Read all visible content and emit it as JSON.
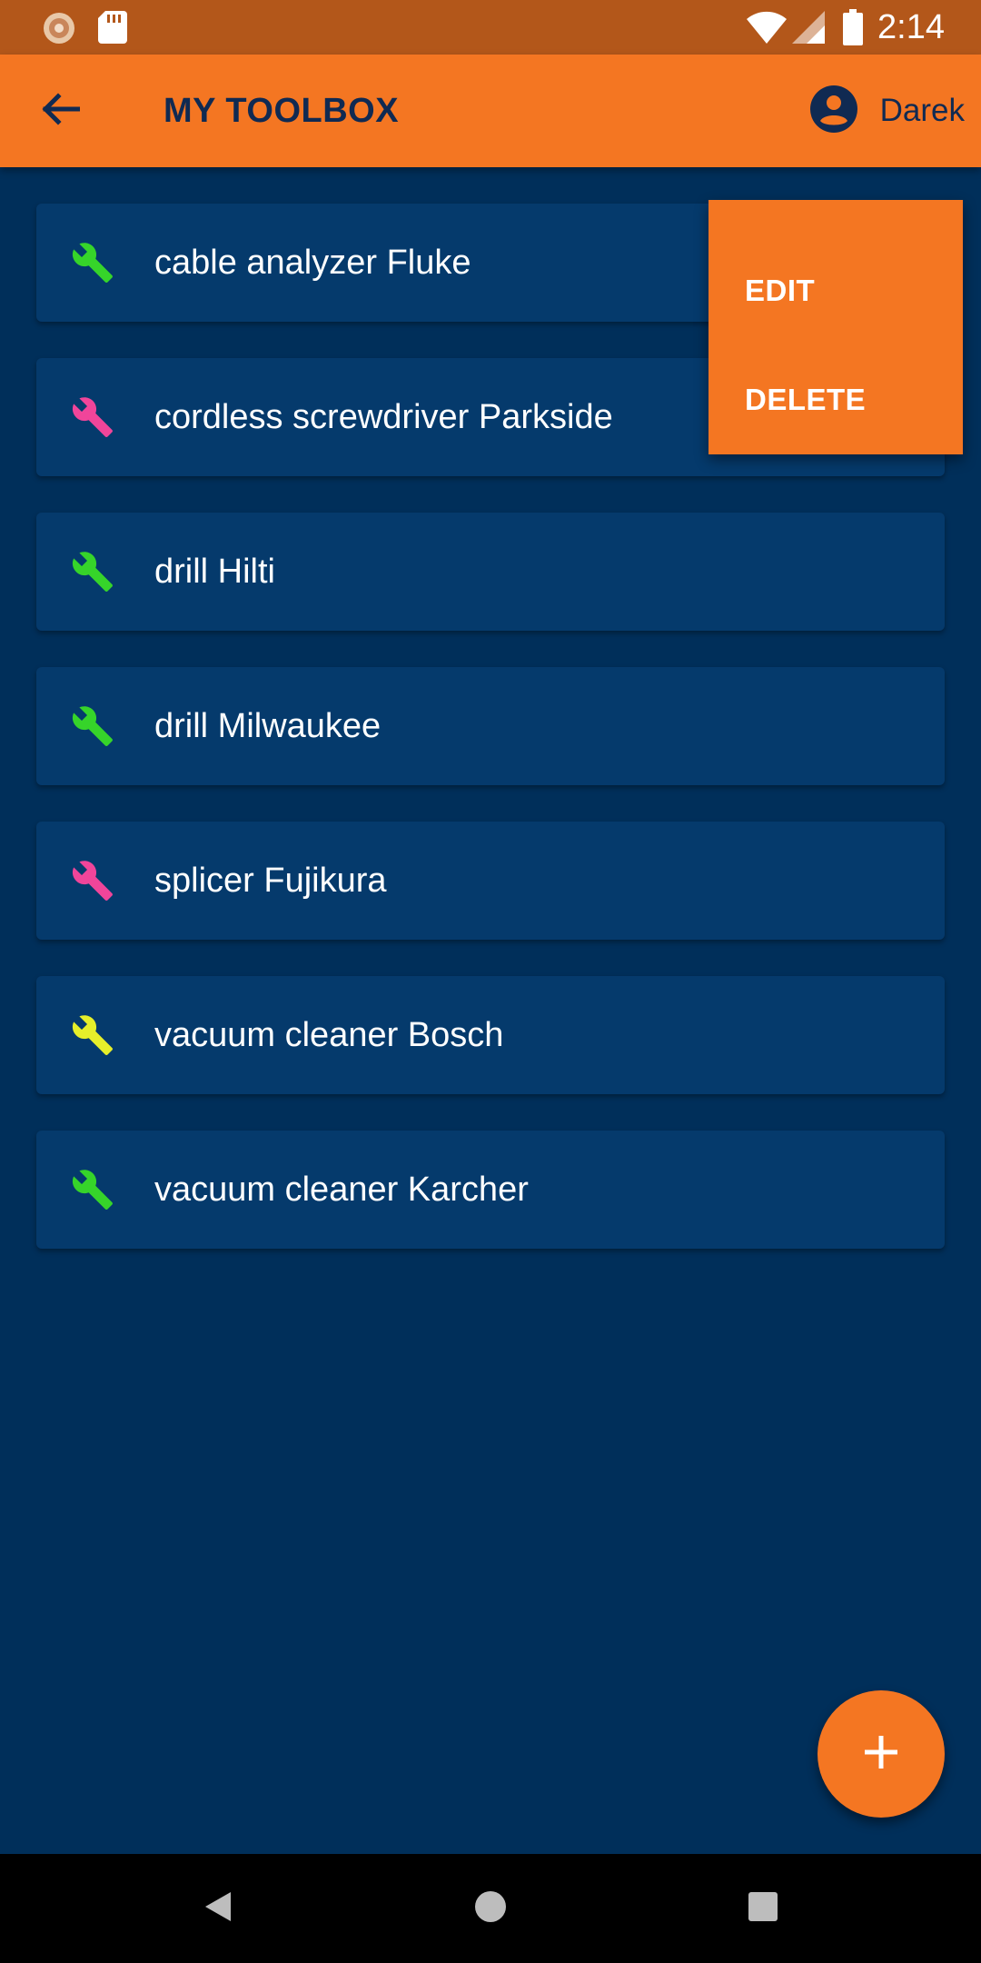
{
  "status_bar": {
    "time": "2:14",
    "icons": [
      "app-notification-icon",
      "sd-card-icon",
      "wifi-icon",
      "signal-icon",
      "battery-icon"
    ]
  },
  "app_bar": {
    "title": "MY TOOLBOX",
    "back_icon": "arrow-back-icon",
    "user_icon": "account-circle-icon",
    "user_name": "Darek"
  },
  "tools": [
    {
      "name": "cable analyzer Fluke",
      "icon": "wrench-icon",
      "color": "#36d42a"
    },
    {
      "name": "cordless screwdriver Parkside",
      "icon": "wrench-icon",
      "color": "#f0459a"
    },
    {
      "name": "drill Hilti",
      "icon": "wrench-icon",
      "color": "#36d42a"
    },
    {
      "name": "drill Milwaukee",
      "icon": "wrench-icon",
      "color": "#36d42a"
    },
    {
      "name": "splicer Fujikura",
      "icon": "wrench-icon",
      "color": "#f0459a"
    },
    {
      "name": "vacuum cleaner Bosch",
      "icon": "wrench-icon",
      "color": "#e6ef2a"
    },
    {
      "name": "vacuum cleaner Karcher",
      "icon": "wrench-icon",
      "color": "#36d42a"
    }
  ],
  "context_menu": {
    "edit_label": "EDIT",
    "delete_label": "DELETE"
  },
  "fab": {
    "icon": "plus-icon"
  },
  "nav_bar": {
    "icons": [
      "back-triangle-icon",
      "home-circle-icon",
      "recents-square-icon"
    ]
  },
  "colors": {
    "background": "#002f5a",
    "card": "#053a6c",
    "accent": "#f47622",
    "status_bar": "#b3571a",
    "title_text": "#102a52"
  }
}
